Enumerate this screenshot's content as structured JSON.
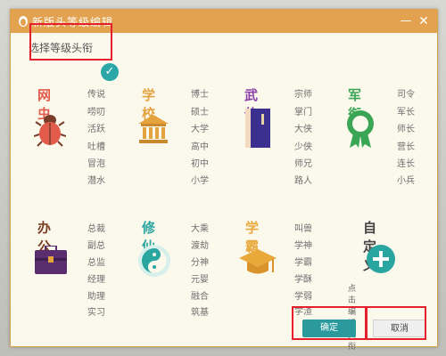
{
  "window": {
    "title": "新版头等级编辑",
    "minimize_glyph": "—",
    "close_glyph": "✕"
  },
  "subtitle": "选择等级头衔",
  "selected_check": "✓",
  "categories": [
    {
      "title": "网虫",
      "color": "#e25b4b",
      "icon": "bug-icon",
      "ranks": [
        "传说",
        "唠叨",
        "活跃",
        "吐槽",
        "冒泡",
        "潜水"
      ]
    },
    {
      "title": "学校",
      "color": "#e5a33f",
      "icon": "school-building-icon",
      "ranks": [
        "博士",
        "硕士",
        "大学",
        "高中",
        "初中",
        "小学"
      ]
    },
    {
      "title": "武侠",
      "color": "#8a3fa6",
      "icon": "book-icon",
      "ranks": [
        "宗师",
        "掌门",
        "大侠",
        "少侠",
        "师兄",
        "路人"
      ]
    },
    {
      "title": "军衔",
      "color": "#3aa555",
      "icon": "medal-icon",
      "ranks": [
        "司令",
        "军长",
        "师长",
        "营长",
        "连长",
        "小兵"
      ]
    },
    {
      "title": "办公",
      "color": "#7b3e22",
      "icon": "briefcase-icon",
      "ranks": [
        "总裁",
        "副总",
        "总监",
        "经理",
        "助理",
        "实习"
      ]
    },
    {
      "title": "修仙",
      "color": "#2aa6a0",
      "icon": "yin-yang-icon",
      "ranks": [
        "大乘",
        "渡劫",
        "分神",
        "元婴",
        "融合",
        "筑基"
      ]
    },
    {
      "title": "学霸",
      "color": "#e8a83a",
      "icon": "graduation-cap-icon",
      "ranks": [
        "叫兽",
        "学神",
        "学霸",
        "学酥",
        "学弱",
        "学渣"
      ]
    },
    {
      "title": "自定义",
      "color": "#444444",
      "icon": "add-icon",
      "ranks": []
    }
  ],
  "custom_edit_label": "点击编辑头衔",
  "buttons": {
    "ok": "确定",
    "cancel": "取消"
  },
  "colors": {
    "accent": "#2a9a9c",
    "titlebar": "#e3a24f",
    "annotation_red": "#e5202c"
  }
}
